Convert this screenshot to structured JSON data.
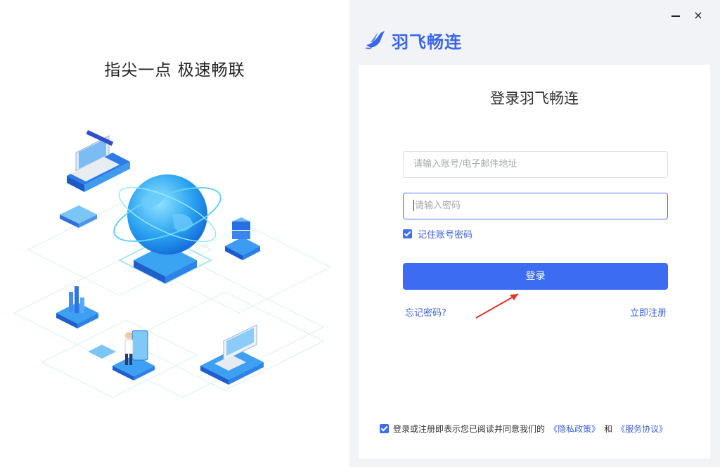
{
  "left": {
    "slogan": "指尖一点 极速畅联"
  },
  "window_controls": {
    "close": "×"
  },
  "brand": {
    "name": "羽飞畅连",
    "color": "#3a66e8"
  },
  "login": {
    "title": "登录羽飞畅连",
    "account_placeholder": "请输入账号/电子邮件地址",
    "password_placeholder": "请输入密码",
    "remember_label": "记住账号密码",
    "remember_checked": true,
    "submit_label": "登录",
    "forgot_label": "忘记密码?",
    "register_label": "立即注册",
    "accent": "#3b6cf2"
  },
  "agreement": {
    "checked": true,
    "text": "登录或注册即表示您已阅读并同意我们的",
    "privacy_link": "《隐私政策》",
    "and": "和",
    "service_link": "《服务协议》"
  }
}
